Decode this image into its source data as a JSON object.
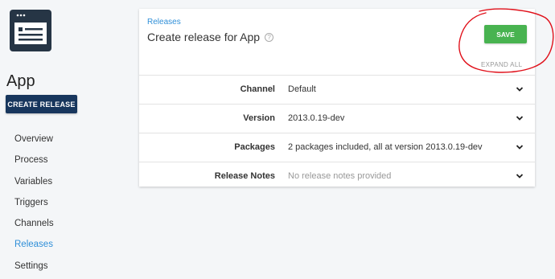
{
  "sidebar": {
    "app_name": "App",
    "create_release_label": "CREATE RELEASE",
    "nav": [
      {
        "label": "Overview",
        "active": false
      },
      {
        "label": "Process",
        "active": false
      },
      {
        "label": "Variables",
        "active": false
      },
      {
        "label": "Triggers",
        "active": false
      },
      {
        "label": "Channels",
        "active": false
      },
      {
        "label": "Releases",
        "active": true
      },
      {
        "label": "Settings",
        "active": false
      }
    ]
  },
  "header": {
    "breadcrumb": "Releases",
    "title": "Create release for App",
    "help_icon": "?",
    "save_label": "SAVE",
    "expand_all_label": "EXPAND ALL"
  },
  "rows": [
    {
      "label": "Channel",
      "value": "Default",
      "muted": false
    },
    {
      "label": "Version",
      "value": "2013.0.19-dev",
      "muted": false
    },
    {
      "label": "Packages",
      "value": "2 packages included, all at version 2013.0.19-dev",
      "muted": false
    },
    {
      "label": "Release Notes",
      "value": "No release notes provided",
      "muted": true
    }
  ],
  "colors": {
    "primary_button": "#17365d",
    "save_button": "#48b350",
    "link": "#2f8fd8",
    "annotation": "#e0101a"
  }
}
